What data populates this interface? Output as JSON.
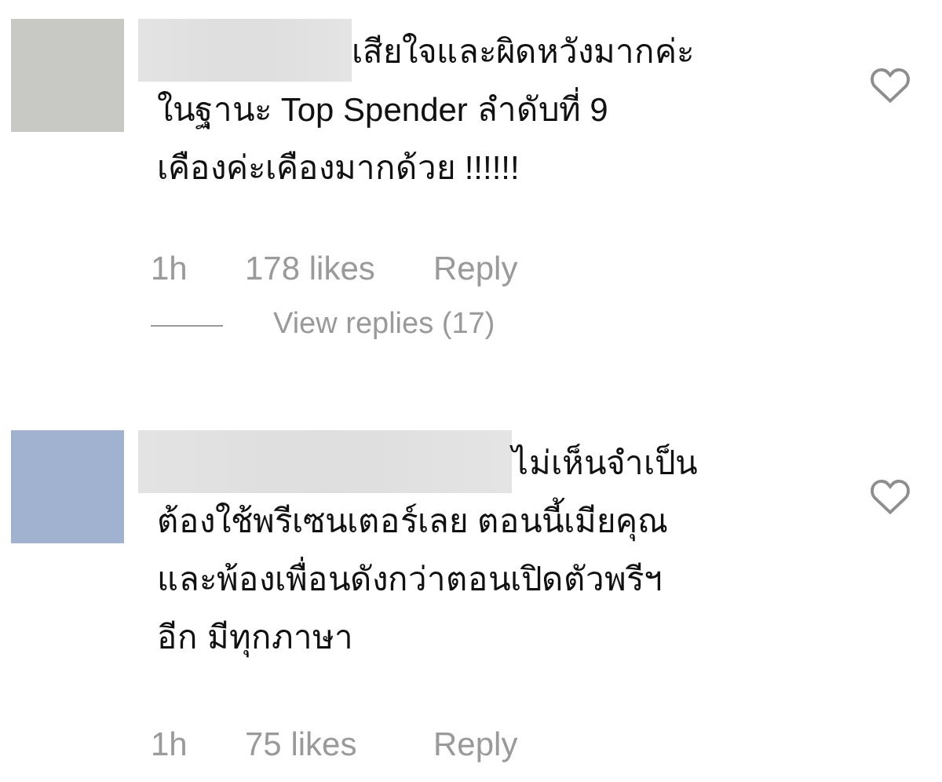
{
  "comments": [
    {
      "color": "#c8c8c4",
      "lines": [
        "เสียใจและผิดหวังมากค่ะ",
        "ในฐานะ Top Spender ลำดับที่ 9",
        "เคืองค่ะเคืองมากด้วย !!!!!!"
      ],
      "time": "1h",
      "likes": "178 likes",
      "reply": "Reply",
      "view_replies": "View replies (17)"
    },
    {
      "color": "#a0b2d0",
      "lines": [
        "ไม่เห็นจำเป็น",
        "ต้องใช้พรีเซนเตอร์เลย ตอนนี้เมียคุณ",
        "และพ้องเพื่อนดังกว่าตอนเปิดตัวพรีฯ",
        "อีก มีทุกภาษา"
      ],
      "time": "1h",
      "likes": "75 likes",
      "reply": "Reply"
    }
  ]
}
